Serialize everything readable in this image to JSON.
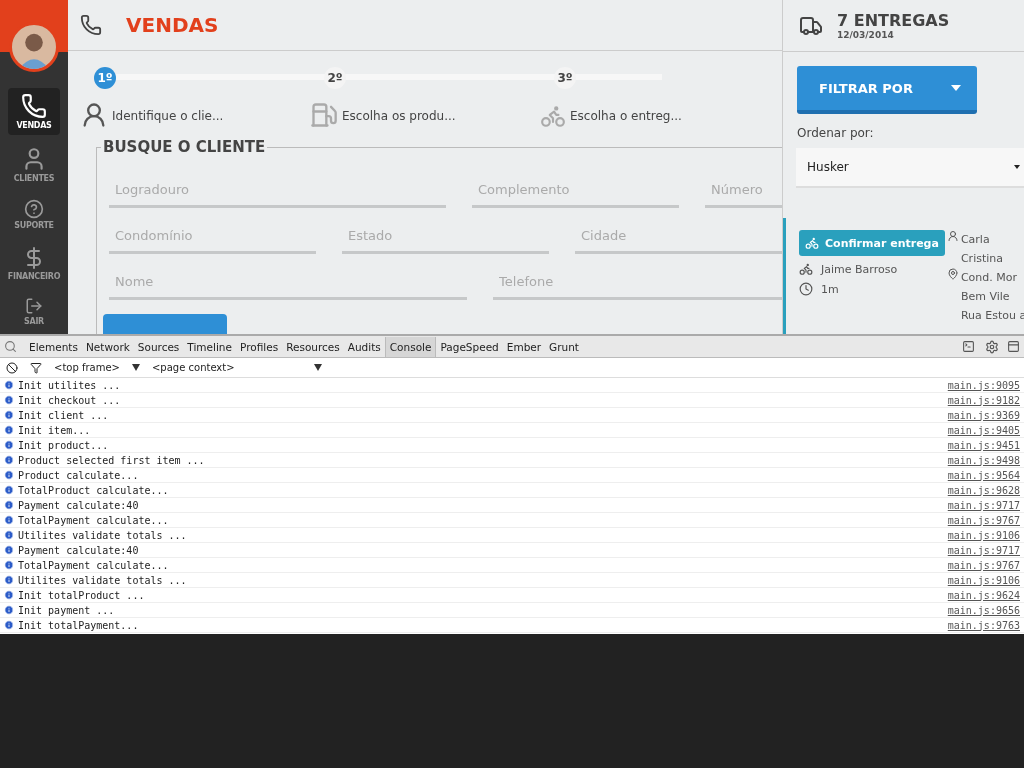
{
  "sidebar": {
    "items": [
      {
        "label": "VENDAS",
        "selected": true
      },
      {
        "label": "CLIENTES",
        "selected": false
      },
      {
        "label": "SUPORTE",
        "selected": false
      },
      {
        "label": "FINANCEIRO",
        "selected": false
      },
      {
        "label": "SAIR",
        "selected": false
      }
    ]
  },
  "header": {
    "title": "VENDAS"
  },
  "steps": [
    {
      "badge": "1º",
      "label": "Identifique o clie...",
      "active": true
    },
    {
      "badge": "2º",
      "label": "Escolha os produ...",
      "active": false
    },
    {
      "badge": "3º",
      "label": "Escolha o entreg...",
      "active": false
    }
  ],
  "form": {
    "legend": "BUSQUE O CLIENTE",
    "rows": [
      [
        {
          "placeholder": "Logradouro"
        },
        {
          "placeholder": "Complemento"
        },
        {
          "placeholder": "Número"
        }
      ],
      [
        {
          "placeholder": "Condomínio"
        },
        {
          "placeholder": "Estado"
        },
        {
          "placeholder": "Cidade"
        }
      ],
      [
        {
          "placeholder": "Nome"
        },
        {
          "placeholder": "Telefone"
        }
      ]
    ]
  },
  "deliveries": {
    "count": "7 ENTREGAS",
    "date": "12/03/2014",
    "filter_button": "FILTRAR POR",
    "sort_label": "Ordenar por:",
    "sort_value": "Husker",
    "card": {
      "confirm": "Confirmar entrega",
      "carrier": "Jaime Barroso",
      "time": "1m",
      "client": [
        "Carla",
        "Cristina"
      ],
      "address": [
        "Cond. Mor",
        "Bem Vile",
        "Rua Estou a"
      ]
    }
  },
  "devtools": {
    "tabs": [
      {
        "label": "Elements",
        "selected": false
      },
      {
        "label": "Network",
        "selected": false
      },
      {
        "label": "Sources",
        "selected": false
      },
      {
        "label": "Timeline",
        "selected": false
      },
      {
        "label": "Profiles",
        "selected": false
      },
      {
        "label": "Resources",
        "selected": false
      },
      {
        "label": "Audits",
        "selected": false
      },
      {
        "label": "Console",
        "selected": true
      },
      {
        "label": "PageSpeed",
        "selected": false
      },
      {
        "label": "Ember",
        "selected": false
      },
      {
        "label": "Grunt",
        "selected": false
      }
    ],
    "frame": "<top frame>",
    "context": "<page context>",
    "messages": [
      {
        "text": "Init utilites ...",
        "source": "main.js:9095"
      },
      {
        "text": "Init checkout ...",
        "source": "main.js:9182"
      },
      {
        "text": "Init client ...",
        "source": "main.js:9369"
      },
      {
        "text": "Init item...",
        "source": "main.js:9405"
      },
      {
        "text": "Init product...",
        "source": "main.js:9451"
      },
      {
        "text": "Product selected first item ...",
        "source": "main.js:9498"
      },
      {
        "text": "Product calculate...",
        "source": "main.js:9564"
      },
      {
        "text": "TotalProduct calculate...",
        "source": "main.js:9628"
      },
      {
        "text": "Payment calculate:40",
        "source": "main.js:9717"
      },
      {
        "text": "TotalPayment calculate...",
        "source": "main.js:9767"
      },
      {
        "text": "Utilites validate totals ...",
        "source": "main.js:9106"
      },
      {
        "text": "Payment calculate:40",
        "source": "main.js:9717"
      },
      {
        "text": "TotalPayment calculate...",
        "source": "main.js:9767"
      },
      {
        "text": "Utilites validate totals ...",
        "source": "main.js:9106"
      },
      {
        "text": "Init totalProduct ...",
        "source": "main.js:9624"
      },
      {
        "text": "Init payment ...",
        "source": "main.js:9656"
      },
      {
        "text": "Init totalPayment...",
        "source": "main.js:9763"
      }
    ]
  }
}
